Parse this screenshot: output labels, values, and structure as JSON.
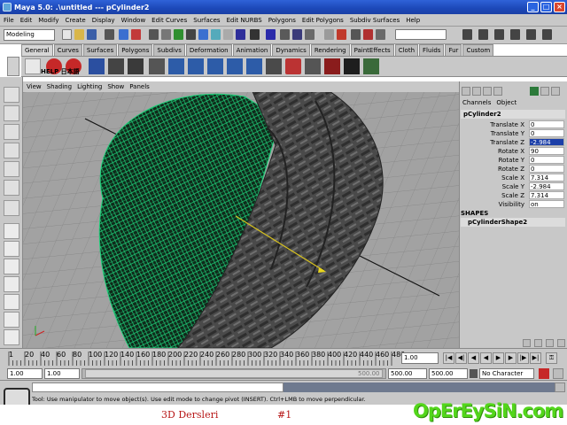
{
  "window": {
    "title": "Maya 5.0: .\\untitled   ---  pCylinder2"
  },
  "menubar": [
    "File",
    "Edit",
    "Modify",
    "Create",
    "Display",
    "Window",
    "Edit Curves",
    "Surfaces",
    "Edit NURBS",
    "Polygons",
    "Edit Polygons",
    "Subdiv Surfaces",
    "Help"
  ],
  "statusline": {
    "mode": "Modeling"
  },
  "shelf": {
    "tabs": [
      "General",
      "Curves",
      "Surfaces",
      "Polygons",
      "Subdivs",
      "Deformation",
      "Animation",
      "Dynamics",
      "Rendering",
      "PaintEffects",
      "Cloth",
      "Fluids",
      "Fur",
      "Custom"
    ],
    "active_tab": "General",
    "help_label": "HELP 日本語"
  },
  "panel": {
    "menus": [
      "View",
      "Shading",
      "Lighting",
      "Show",
      "Panels"
    ]
  },
  "channelbox": {
    "menus": [
      "Channels",
      "Object"
    ],
    "object_name": "pCylinder2",
    "attributes": [
      {
        "label": "Translate X",
        "value": "0"
      },
      {
        "label": "Translate Y",
        "value": "0"
      },
      {
        "label": "Translate Z",
        "value": "-2.984"
      },
      {
        "label": "Rotate X",
        "value": "90"
      },
      {
        "label": "Rotate Y",
        "value": "0"
      },
      {
        "label": "Rotate Z",
        "value": "0"
      },
      {
        "label": "Scale X",
        "value": "7.314"
      },
      {
        "label": "Scale Y",
        "value": "-2.984"
      },
      {
        "label": "Scale Z",
        "value": "7.314"
      },
      {
        "label": "Visibility",
        "value": "on"
      }
    ],
    "shapes_header": "SHAPES",
    "shape_name": "pCylinderShape2"
  },
  "timeslider": {
    "ticks": [
      "20",
      "40",
      "60",
      "80",
      "100",
      "120",
      "140",
      "160",
      "180",
      "200",
      "220",
      "240",
      "260",
      "280",
      "300",
      "320",
      "340",
      "360",
      "380",
      "400",
      "420",
      "440",
      "460",
      "480"
    ],
    "current_frame": "1.00",
    "first_tick": "1"
  },
  "rangeslider": {
    "start": "1.00",
    "start2": "1.00",
    "inner_end": "500.00",
    "end": "500.00",
    "end2": "500.00",
    "character_set": "No Character Set"
  },
  "helpline": {
    "message": "Tool: Use manipulator to move object(s). Use edit mode to change pivot (INSERT).  Ctrl+LMB to move perpendicular."
  },
  "caption": {
    "text": "3D Dersleri",
    "number": "#1"
  },
  "watermark": {
    "text": "OpErEySiN.com"
  }
}
